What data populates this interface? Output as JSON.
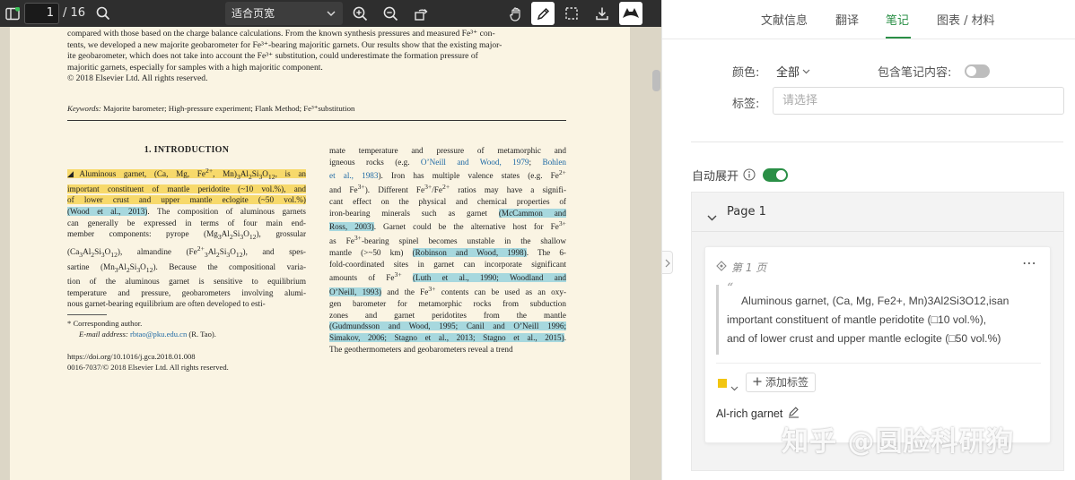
{
  "toolbar": {
    "current_page": "1",
    "total_pages": "/ 16",
    "zoom_mode": "适合页宽",
    "icons": [
      "sidebar-icon",
      "search-icon",
      "zoom-in-icon",
      "zoom-out-icon",
      "rotate-icon",
      "hand-icon",
      "pen-icon",
      "select-icon",
      "download-icon",
      "cat-icon"
    ]
  },
  "document": {
    "abstract_lines": [
      "compared with those based on the charge balance calculations. From the known synthesis pressures and measured Fe³⁺ con-",
      "tents, we developed a new majorite geobarometer for Fe³⁺-bearing majoritic garnets. Our results show that the existing major-",
      "ite geobarometer, which does not take into account the Fe³⁺ substitution, could underestimate the formation pressure of",
      "majoritic garnets, especially for samples with a high majoritic component.",
      "© 2018 Elsevier Ltd. All rights reserved."
    ],
    "keywords_label": "Keywords:",
    "keywords": "Majorite barometer; High-pressure experiment; Flank Method; Fe³⁺substitution",
    "section_title": "1. INTRODUCTION",
    "footnote_author": "* Corresponding author.",
    "footnote_email_label": "E-mail address:",
    "footnote_email": "rbtao@pku.edu.cn",
    "footnote_email_suffix": "(R. Tao).",
    "doi": "https://doi.org/10.1016/j.gca.2018.01.008",
    "issn": "0016-7037/© 2018 Elsevier Ltd. All rights reserved."
  },
  "panel": {
    "tabs": [
      "文献信息",
      "翻译",
      "笔记",
      "图表 / 材料"
    ],
    "active_tab": "笔记",
    "color_label": "颜色:",
    "color_value": "全部",
    "include_note_label": "包含笔记内容:",
    "tag_label": "标签:",
    "tag_placeholder": "请选择",
    "auto_expand_label": "自动展开",
    "group_title": "Page 1",
    "note": {
      "page_ref": "第 1 页",
      "quote_lines": [
        "Aluminous garnet, (Ca, Mg, Fe2+, Mn)3Al2Si3O12,isan",
        "important constituent of mantle peridotite (□10 vol.%),",
        "and of lower crust and upper mantle eclogite (□50 vol.%)"
      ],
      "add_tag_label": "添加标签",
      "note_text": "Al-rich garnet",
      "highlight_color": "#f2c511"
    }
  },
  "watermark": "知乎 @圆脸科研狗",
  "colors": {
    "accent": "#2a8f46",
    "toolbar_bg": "#2e2e2e",
    "page_bg": "#faf4e3",
    "highlight_yellow": "#f7d96b",
    "highlight_blue": "#a7d8de"
  }
}
